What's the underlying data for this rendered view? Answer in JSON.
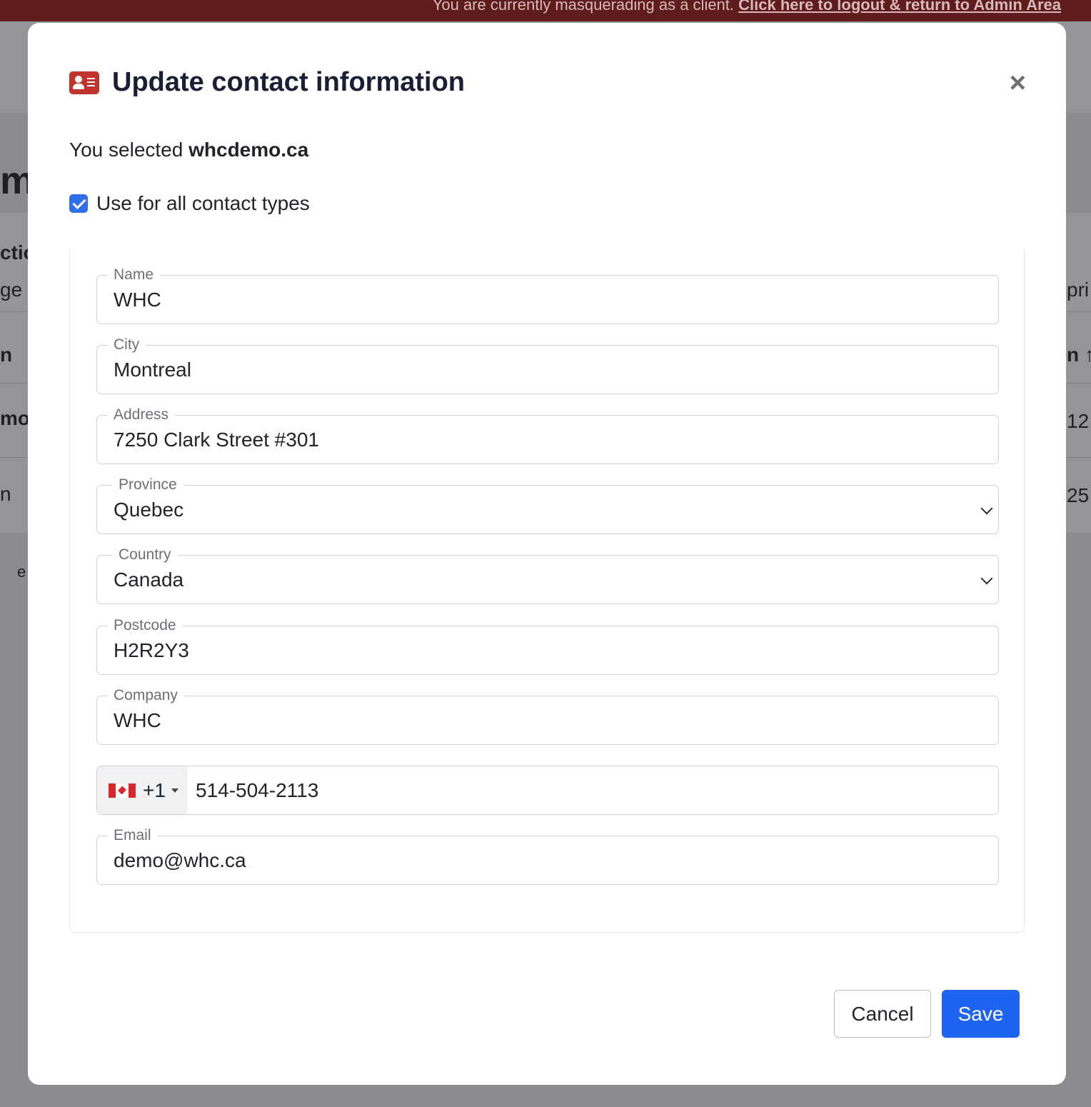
{
  "banner": {
    "text": "You are currently masquerading as a client. ",
    "link": "Click here to logout & return to Admin Area"
  },
  "background": {
    "fragments": [
      "m",
      "ctio",
      "ge",
      "n",
      "mo",
      "n",
      "e",
      "pri",
      "n ↑",
      "12",
      "25"
    ]
  },
  "modal": {
    "title": "Update contact information",
    "title_icon": "contact-card-icon",
    "close_icon": "close-icon",
    "close_glyph": "×",
    "selected_prefix": "You selected ",
    "selected_domain": "whcdemo.ca",
    "use_all_label": "Use for all contact types",
    "use_all_checked": true
  },
  "fields": {
    "name": {
      "label": "Name",
      "value": "WHC"
    },
    "city": {
      "label": "City",
      "value": "Montreal"
    },
    "address": {
      "label": "Address",
      "value": "7250 Clark Street #301"
    },
    "province": {
      "label": "Province",
      "value": "Quebec"
    },
    "country": {
      "label": "Country",
      "value": "Canada"
    },
    "postcode": {
      "label": "Postcode",
      "value": "H2R2Y3"
    },
    "company": {
      "label": "Company",
      "value": "WHC"
    },
    "phone": {
      "flag_icon": "canada-flag-icon",
      "dial_code": "+1",
      "value": "514-504-2113"
    },
    "email": {
      "label": "Email",
      "value": "demo@whc.ca"
    }
  },
  "buttons": {
    "cancel": "Cancel",
    "save": "Save"
  },
  "colors": {
    "primary": "#1e63f2",
    "icon_red": "#c0342d",
    "banner": "#5e1c1c"
  }
}
